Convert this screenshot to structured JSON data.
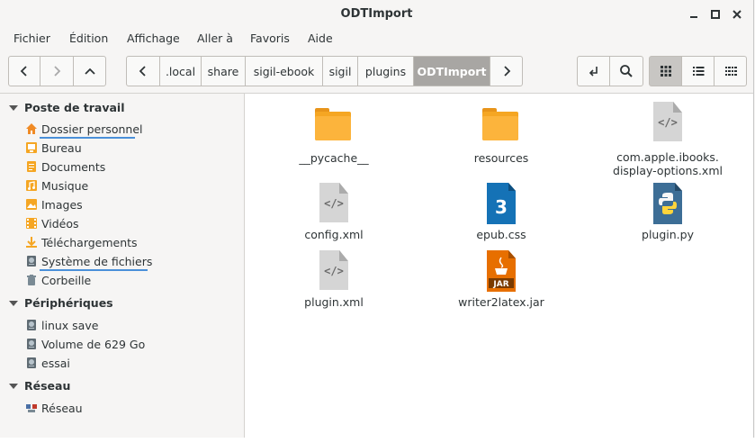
{
  "window": {
    "title": "ODTImport",
    "controls": [
      "minimize",
      "maximize",
      "close"
    ]
  },
  "menu": [
    "Fichier",
    "Édition",
    "Affichage",
    "Aller à",
    "Favoris",
    "Aide"
  ],
  "toolbar": {
    "path": [
      ".local",
      "share",
      "sigil-ebook",
      "sigil",
      "plugins",
      "ODTImport"
    ]
  },
  "sidebar": {
    "sections": [
      {
        "title": "Poste de travail",
        "items": [
          "Dossier personnel",
          "Bureau",
          "Documents",
          "Musique",
          "Images",
          "Vidéos",
          "Téléchargements",
          "Système de fichiers",
          "Corbeille"
        ]
      },
      {
        "title": "Périphériques",
        "items": [
          "linux save",
          "Volume de 629 Go",
          "essai"
        ]
      },
      {
        "title": "Réseau",
        "items": [
          "Réseau"
        ]
      }
    ]
  },
  "files": [
    {
      "name": "__pycache__",
      "type": "folder"
    },
    {
      "name": "resources",
      "type": "folder"
    },
    {
      "name": "com.apple.ibooks.\ndisplay-options.xml",
      "type": "xml"
    },
    {
      "name": "config.xml",
      "type": "xml"
    },
    {
      "name": "epub.css",
      "type": "css"
    },
    {
      "name": "plugin.py",
      "type": "python"
    },
    {
      "name": "plugin.xml",
      "type": "xml"
    },
    {
      "name": "writer2latex.jar",
      "type": "jar"
    }
  ],
  "icons": {
    "jar_badge": "JAR",
    "css_badge": "3"
  },
  "colors": {
    "folder": "#fcb43c",
    "css": "#1572b6",
    "python": "#3d6e96",
    "jar": "#e76f00",
    "selection_underline": "#4a90d9"
  }
}
